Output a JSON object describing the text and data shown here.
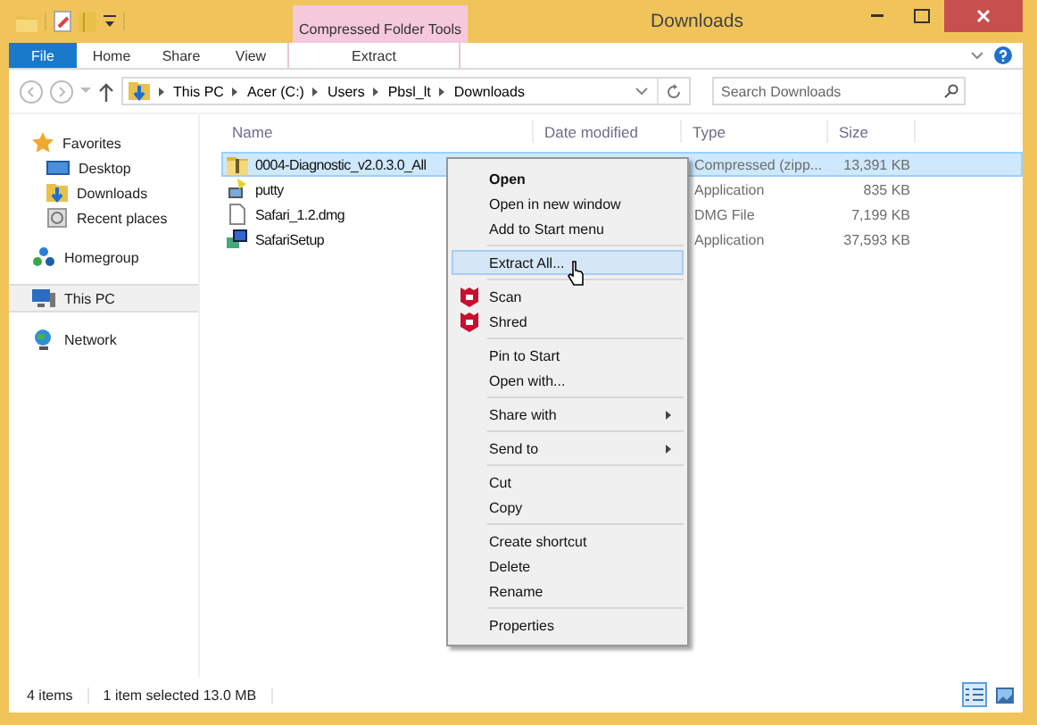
{
  "window": {
    "title": "Downloads",
    "contextual_group": "Compressed Folder Tools"
  },
  "ribbon_tabs": [
    {
      "label": "File",
      "kind": "file"
    },
    {
      "label": "Home",
      "kind": "tab"
    },
    {
      "label": "Share",
      "kind": "tab"
    },
    {
      "label": "View",
      "kind": "tab"
    },
    {
      "label": "Extract",
      "kind": "contextual"
    }
  ],
  "address": {
    "path": [
      "This PC",
      "Acer (C:)",
      "Users",
      "Pbsl_lt",
      "Downloads"
    ]
  },
  "search": {
    "placeholder": "Search Downloads"
  },
  "navigation": [
    {
      "label": "Favorites",
      "kind": "star",
      "selected": false,
      "children": [
        {
          "label": "Desktop",
          "kind": "desktop",
          "selected": false
        },
        {
          "label": "Downloads",
          "kind": "downloads",
          "selected": false
        },
        {
          "label": "Recent places",
          "kind": "recent",
          "selected": false
        }
      ]
    },
    {
      "label": "Homegroup",
      "kind": "homegroup",
      "selected": false
    },
    {
      "label": "This PC",
      "kind": "pc",
      "selected": true
    },
    {
      "label": "Network",
      "kind": "network",
      "selected": false
    }
  ],
  "columns": [
    "Name",
    "Date modified",
    "Type",
    "Size"
  ],
  "files": [
    {
      "name": "0004-Diagnostic_v2.0.3.0_All",
      "kind": "zip",
      "type": "Compressed (zipp...",
      "size": "13,391 KB",
      "selected": true
    },
    {
      "name": "putty",
      "kind": "app",
      "type": "Application",
      "size": "835 KB",
      "selected": false
    },
    {
      "name": "Safari_1.2.dmg",
      "kind": "file",
      "type": "DMG File",
      "size": "7,199 KB",
      "selected": false
    },
    {
      "name": "SafariSetup",
      "kind": "setup",
      "type": "Application",
      "size": "37,593 KB",
      "selected": false
    }
  ],
  "context_menu": [
    [
      {
        "label": "Open",
        "kind": "default",
        "highlighted": false
      },
      {
        "label": "Open in new window",
        "kind": "plain",
        "highlighted": false
      },
      {
        "label": "Add to Start menu",
        "kind": "plain",
        "highlighted": false
      }
    ],
    [
      {
        "label": "Extract All...",
        "kind": "plain",
        "highlighted": true
      }
    ],
    [
      {
        "label": "Scan",
        "kind": "shield",
        "highlighted": false
      },
      {
        "label": "Shred",
        "kind": "shield",
        "highlighted": false
      }
    ],
    [
      {
        "label": "Pin to Start",
        "kind": "plain",
        "highlighted": false
      },
      {
        "label": "Open with...",
        "kind": "plain",
        "highlighted": false
      }
    ],
    [
      {
        "label": "Share with",
        "kind": "submenu",
        "highlighted": false
      }
    ],
    [
      {
        "label": "Send to",
        "kind": "submenu",
        "highlighted": false
      }
    ],
    [
      {
        "label": "Cut",
        "kind": "plain",
        "highlighted": false
      },
      {
        "label": "Copy",
        "kind": "plain",
        "highlighted": false
      }
    ],
    [
      {
        "label": "Create shortcut",
        "kind": "plain",
        "highlighted": false
      },
      {
        "label": "Delete",
        "kind": "plain",
        "highlighted": false
      },
      {
        "label": "Rename",
        "kind": "plain",
        "highlighted": false
      }
    ],
    [
      {
        "label": "Properties",
        "kind": "plain",
        "highlighted": false
      }
    ]
  ],
  "status_bar": {
    "item_count": "4 items",
    "selection": "1 item selected  13.0 MB",
    "views": [
      {
        "kind": "details",
        "selected": true
      },
      {
        "kind": "large-icons",
        "selected": false
      }
    ]
  }
}
